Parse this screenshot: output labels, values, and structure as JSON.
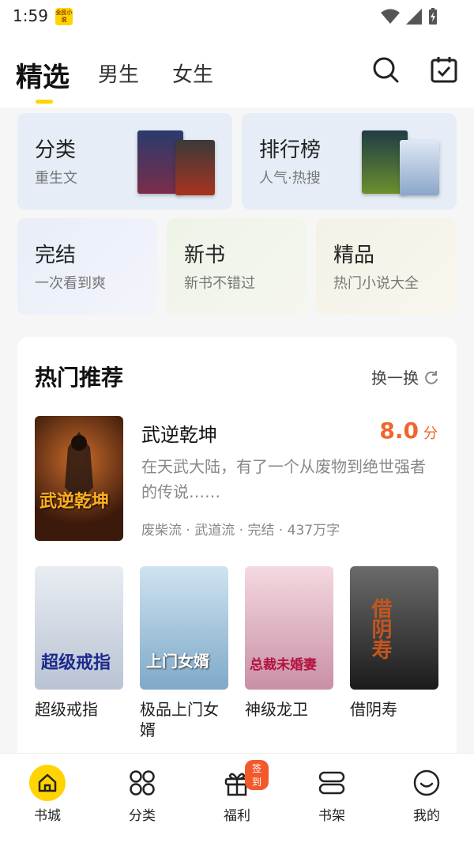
{
  "status": {
    "time": "1:59",
    "app_badge": "全民小说"
  },
  "tabs": [
    {
      "label": "精选"
    },
    {
      "label": "男生"
    },
    {
      "label": "女生"
    }
  ],
  "tiles": {
    "category": {
      "title": "分类",
      "sub": "重生文"
    },
    "ranking": {
      "title": "排行榜",
      "sub": "人气·热搜"
    },
    "finished": {
      "title": "完结",
      "sub": "一次看到爽"
    },
    "newbook": {
      "title": "新书",
      "sub": "新书不错过"
    },
    "premium": {
      "title": "精品",
      "sub": "热门小说大全"
    }
  },
  "hot": {
    "title": "热门推荐",
    "refresh": "换一换",
    "featured": {
      "title": "武逆乾坤",
      "score": "8.0",
      "score_unit": "分",
      "desc": "在天武大陆，有了一个从废物到绝世强者的传说……",
      "tags": "废柴流 · 武道流 · 完结 · 437万字",
      "cover_text": "武逆乾坤"
    },
    "books": [
      {
        "title": "超级戒指",
        "cover_text": "超级戒指"
      },
      {
        "title": "极品上门女婿",
        "cover_text": "上门女婿"
      },
      {
        "title": "神级龙卫",
        "cover_text": "总裁未婚妻"
      },
      {
        "title": "借阴寿",
        "cover_text": "借阴寿"
      }
    ]
  },
  "bottom_nav": {
    "items": [
      {
        "label": "书城"
      },
      {
        "label": "分类"
      },
      {
        "label": "福利"
      },
      {
        "label": "书架"
      },
      {
        "label": "我的"
      }
    ],
    "welfare_badge": "签到"
  },
  "colors": {
    "accent": "#ffd400",
    "score": "#f2642f"
  }
}
